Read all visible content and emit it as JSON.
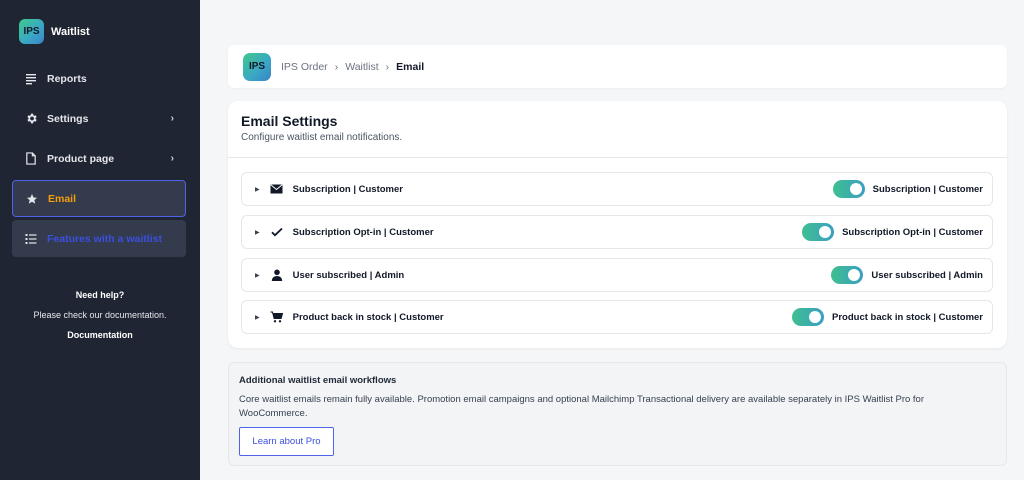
{
  "app": {
    "logo_text": "IPS",
    "name": "Waitlist"
  },
  "sidebar": {
    "items": [
      {
        "label": "Reports",
        "icon": "list-lines-icon"
      },
      {
        "label": "Settings",
        "icon": "gear-icon",
        "has_submenu": true
      },
      {
        "label": "Product page",
        "icon": "document-icon",
        "has_submenu": true
      },
      {
        "label": "Email",
        "icon": "star-icon",
        "active": true
      },
      {
        "label": "Features with a waitlist",
        "icon": "list-check-icon"
      }
    ],
    "help": {
      "title": "Need help?",
      "text": "Please check our documentation.",
      "link": "Documentation"
    }
  },
  "header": {
    "logo_text": "IPS",
    "breadcrumbs": [
      "IPS Order",
      "Waitlist",
      "Email"
    ],
    "separator": "›"
  },
  "email_settings": {
    "title": "Email Settings",
    "subtitle": "Configure waitlist email notifications.",
    "rows": [
      {
        "title": "Subscription | Customer",
        "icon": "envelope-icon",
        "enabled": true,
        "toggle_label": "Subscription | Customer"
      },
      {
        "title": "Subscription Opt-in | Customer",
        "icon": "check-icon",
        "enabled": true,
        "toggle_label": "Subscription Opt-in | Customer"
      },
      {
        "title": "User subscribed | Admin",
        "icon": "user-icon",
        "enabled": true,
        "toggle_label": "User subscribed | Admin"
      },
      {
        "title": "Product back in stock | Customer",
        "icon": "cart-icon",
        "enabled": true,
        "toggle_label": "Product back in stock | Customer"
      }
    ]
  },
  "pro": {
    "title": "Additional waitlist email workflows",
    "text": "Core waitlist emails remain fully available. Promotion email campaigns and optional Mailchimp Transactional delivery are available separately in IPS Waitlist Pro for WooCommerce.",
    "button": "Learn about Pro"
  },
  "colors": {
    "sidebar_bg": "#1f2532",
    "active_accent": "#f59e0b",
    "link_blue": "#3b4fe0",
    "toggle_start": "#3fbf8f",
    "toggle_end": "#3a9fc3"
  }
}
